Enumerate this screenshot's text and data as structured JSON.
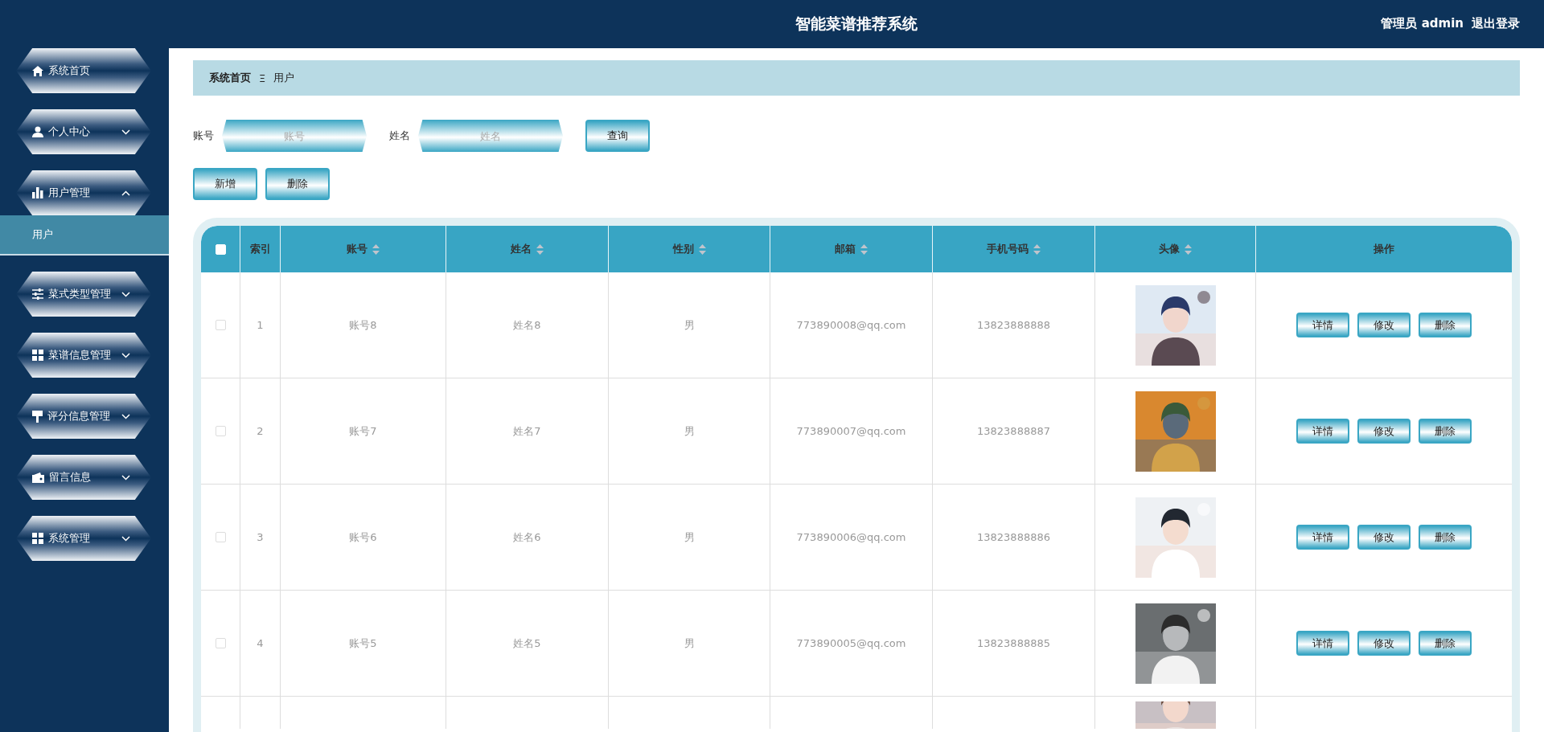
{
  "header": {
    "title": "智能菜谱推荐系统",
    "user": "管理员 admin",
    "logout": "退出登录"
  },
  "sidebar": {
    "items": [
      {
        "label": "系统首页",
        "expandable": false
      },
      {
        "label": "个人中心",
        "expandable": true,
        "expanded": false
      },
      {
        "label": "用户管理",
        "expandable": true,
        "expanded": true,
        "children": [
          {
            "label": "用户",
            "selected": true
          }
        ]
      },
      {
        "label": "菜式类型管理",
        "expandable": true,
        "expanded": false
      },
      {
        "label": "菜谱信息管理",
        "expandable": true,
        "expanded": false
      },
      {
        "label": "评分信息管理",
        "expandable": true,
        "expanded": false
      },
      {
        "label": "留言信息",
        "expandable": true,
        "expanded": false
      },
      {
        "label": "系统管理",
        "expandable": true,
        "expanded": false
      }
    ]
  },
  "breadcrumb": {
    "home": "系统首页",
    "separator": "Ξ",
    "current": "用户"
  },
  "search": {
    "fields": [
      {
        "label": "账号",
        "placeholder": "账号"
      },
      {
        "label": "姓名",
        "placeholder": "姓名"
      }
    ],
    "button": "查询"
  },
  "actions": [
    "新增",
    "删除"
  ],
  "table": {
    "columns": [
      {
        "label": "索引",
        "sortable": false
      },
      {
        "label": "账号",
        "sortable": true
      },
      {
        "label": "姓名",
        "sortable": true
      },
      {
        "label": "性别",
        "sortable": true
      },
      {
        "label": "邮箱",
        "sortable": true
      },
      {
        "label": "手机号码",
        "sortable": true
      },
      {
        "label": "头像",
        "sortable": true
      },
      {
        "label": "操作",
        "sortable": false
      }
    ],
    "select_all": {
      "checked": false
    },
    "rows": [
      {
        "kind": "full",
        "checked": false,
        "index": "1",
        "account": "账号8",
        "name": "姓名8",
        "gender": "男",
        "email": "773890008@qq.com",
        "phone": "13823888888",
        "buttons": [
          "详情",
          "修改",
          "删除"
        ]
      },
      {
        "kind": "full",
        "checked": false,
        "index": "2",
        "account": "账号7",
        "name": "姓名7",
        "gender": "男",
        "email": "773890007@qq.com",
        "phone": "13823888887",
        "buttons": [
          "详情",
          "修改",
          "删除"
        ]
      },
      {
        "kind": "full",
        "checked": false,
        "index": "3",
        "account": "账号6",
        "name": "姓名6",
        "gender": "男",
        "email": "773890006@qq.com",
        "phone": "13823888886",
        "buttons": [
          "详情",
          "修改",
          "删除"
        ]
      },
      {
        "kind": "full",
        "checked": false,
        "index": "4",
        "account": "账号5",
        "name": "姓名5",
        "gender": "男",
        "email": "773890005@qq.com",
        "phone": "13823888885",
        "buttons": [
          "详情",
          "修改",
          "删除"
        ]
      },
      {
        "kind": "cut"
      }
    ]
  }
}
